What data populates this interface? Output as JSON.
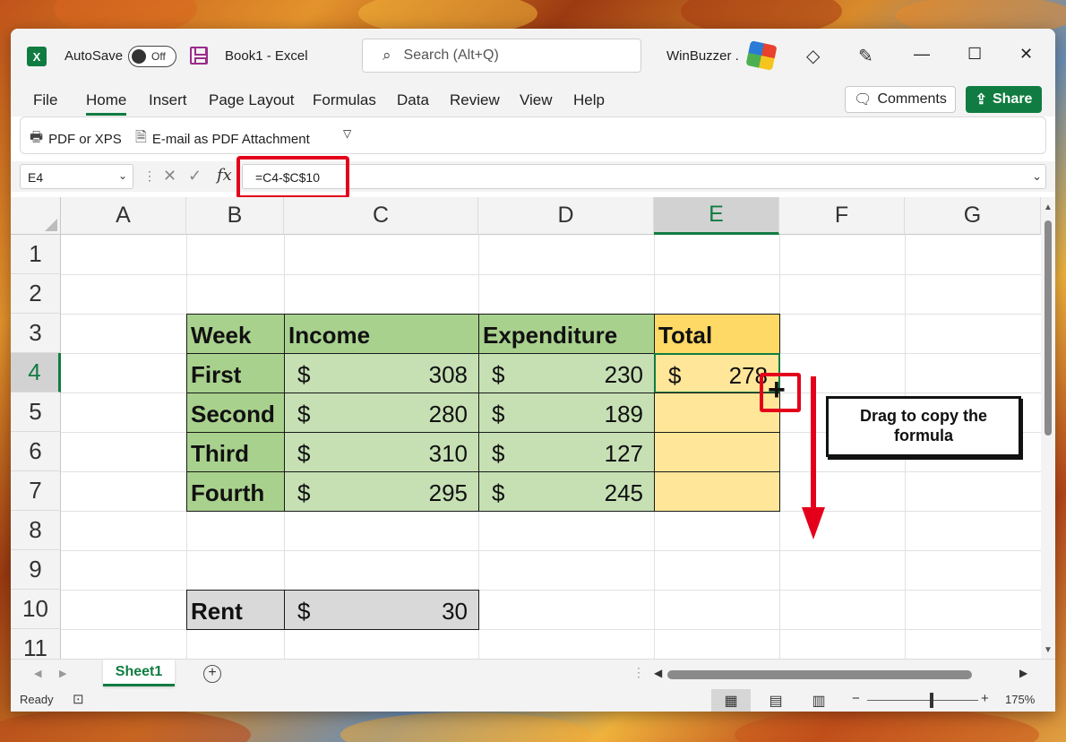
{
  "titlebar": {
    "app_icon": "excel-logo",
    "autosave_label": "AutoSave",
    "autosave_state": "Off",
    "doc_title": "Book1  -  Excel",
    "search_placeholder": "Search (Alt+Q)",
    "user_name": "WinBuzzer ."
  },
  "menu": {
    "items": [
      "File",
      "Home",
      "Insert",
      "Page Layout",
      "Formulas",
      "Data",
      "Review",
      "View",
      "Help"
    ],
    "active": "Home",
    "comments_label": "Comments",
    "share_label": "Share",
    "share_color": "#107c41"
  },
  "ribbon": {
    "pdf_label": "PDF or XPS",
    "email_label": "E-mail as PDF Attachment"
  },
  "formula_bar": {
    "name_box": "E4",
    "fx_label": "fx",
    "formula": "=C4-$C$10"
  },
  "grid": {
    "columns": [
      "A",
      "B",
      "C",
      "D",
      "E",
      "F",
      "G"
    ],
    "rows": [
      "1",
      "2",
      "3",
      "4",
      "5",
      "6",
      "7",
      "8",
      "9",
      "10",
      "11"
    ],
    "selected_column": "E",
    "selected_row": "4",
    "header_row": [
      "Week",
      "Income",
      "Expenditure",
      "Total"
    ],
    "data_rows": [
      {
        "week": "First",
        "income": "308",
        "expenditure": "230",
        "total": "278"
      },
      {
        "week": "Second",
        "income": "280",
        "expenditure": "189",
        "total": ""
      },
      {
        "week": "Third",
        "income": "310",
        "expenditure": "127",
        "total": ""
      },
      {
        "week": "Fourth",
        "income": "295",
        "expenditure": "245",
        "total": ""
      }
    ],
    "currency_symbol": "$",
    "rent_label": "Rent",
    "rent_value": "30",
    "colors": {
      "green_dark": "#a9d18e",
      "green_light": "#c6e0b4",
      "yellow_dark": "#ffd966",
      "yellow_light": "#ffe699",
      "gray": "#d9d9d9",
      "annotation_red": "#e4001b"
    }
  },
  "annotation": {
    "callout_text": "Drag to copy the formula"
  },
  "sheet_tabs": {
    "active": "Sheet1"
  },
  "status": {
    "ready_label": "Ready",
    "zoom_level": "175%"
  }
}
